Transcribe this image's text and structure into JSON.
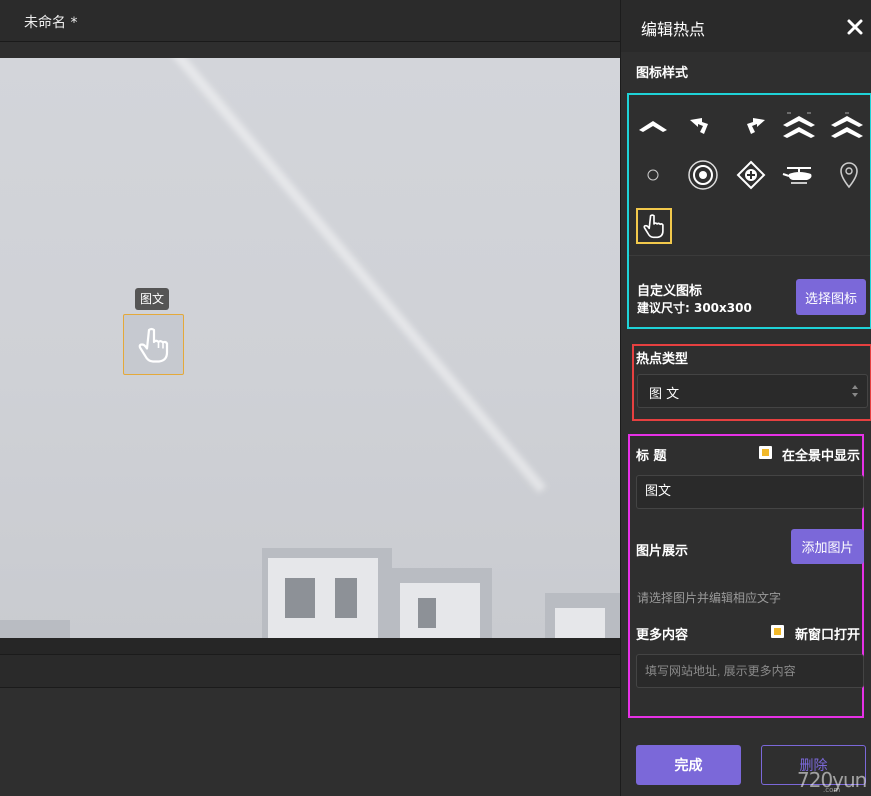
{
  "document": {
    "title": "未命名 *"
  },
  "hotspot": {
    "tooltip": "图文"
  },
  "panel": {
    "title": "编辑热点",
    "icon_style_label": "图标样式",
    "icons": [
      "chevron-up-icon",
      "turn-left-arrow-icon",
      "turn-right-arrow-icon",
      "double-chevron-up-icon",
      "double-chevron-up-alt-icon",
      "small-circle-icon",
      "target-circle-icon",
      "diamond-marker-icon",
      "helicopter-icon",
      "map-pin-icon",
      "pointing-hand-icon"
    ],
    "selected_icon": "pointing-hand-icon",
    "custom_icon_label": "自定义图标",
    "custom_icon_hint": "建议尺寸: 300x300",
    "choose_icon_button": "选择图标",
    "hotspot_type_label": "热点类型",
    "hotspot_type_value": "图 文",
    "title_label": "标 题",
    "show_in_pano_label": "在全景中显示",
    "show_in_pano_checked": true,
    "title_value": "图文",
    "images_label": "图片展示",
    "add_image_button": "添加图片",
    "images_hint": "请选择图片并编辑相应文字",
    "more_content_label": "更多内容",
    "new_window_label": "新窗口打开",
    "new_window_checked": true,
    "url_placeholder": "填写网站地址, 展示更多内容",
    "done_button": "完成",
    "delete_button": "删除"
  },
  "watermark": {
    "text": "720yun",
    "sub": ".com"
  },
  "colors": {
    "accent": "#7b68d9",
    "highlight_cyan": "#1fd3d8",
    "highlight_red": "#e64040",
    "highlight_magenta": "#e631e6",
    "checkbox": "#f2b92a"
  }
}
